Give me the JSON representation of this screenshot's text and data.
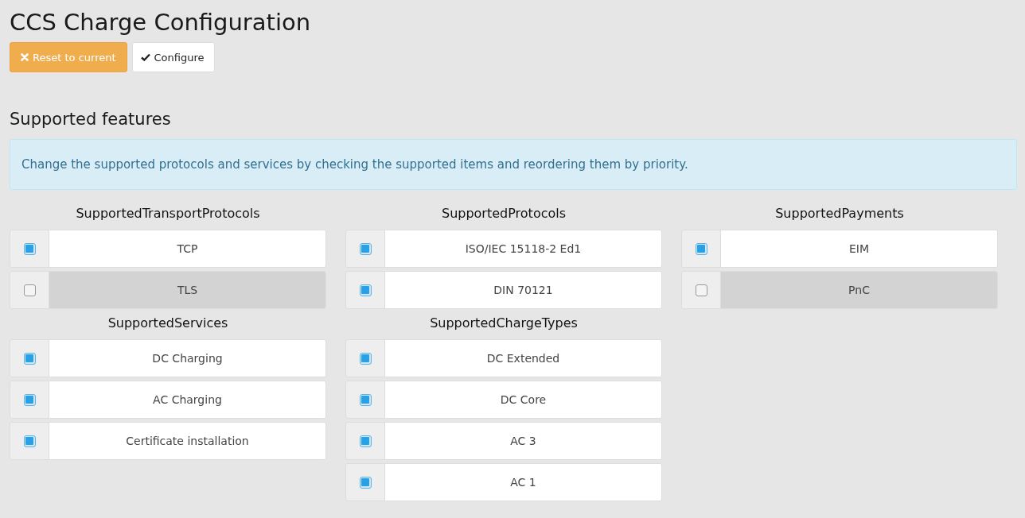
{
  "title": "CCS Charge Configuration",
  "buttons": [
    {
      "kind": "reset",
      "label": "Reset to current"
    },
    {
      "kind": "configure",
      "label": "Configure"
    }
  ],
  "section_title": "Supported features",
  "info": "Change the supported protocols and services by checking the supported items and reordering them by priority.",
  "groups": [
    {
      "title": "SupportedTransportProtocols",
      "items": [
        {
          "label": "TCP",
          "checked": true
        },
        {
          "label": "TLS",
          "checked": false
        }
      ]
    },
    {
      "title": "SupportedProtocols",
      "items": [
        {
          "label": "ISO/IEC 15118-2 Ed1",
          "checked": true
        },
        {
          "label": "DIN 70121",
          "checked": true
        }
      ]
    },
    {
      "title": "SupportedPayments",
      "items": [
        {
          "label": "EIM",
          "checked": true
        },
        {
          "label": "PnC",
          "checked": false
        }
      ]
    },
    {
      "title": "SupportedServices",
      "items": [
        {
          "label": "DC Charging",
          "checked": true
        },
        {
          "label": "AC Charging",
          "checked": true
        },
        {
          "label": "Certificate installation",
          "checked": true
        }
      ]
    },
    {
      "title": "SupportedChargeTypes",
      "items": [
        {
          "label": "DC Extended",
          "checked": true
        },
        {
          "label": "DC Core",
          "checked": true
        },
        {
          "label": "AC 3",
          "checked": true
        },
        {
          "label": "AC 1",
          "checked": true
        }
      ]
    }
  ]
}
